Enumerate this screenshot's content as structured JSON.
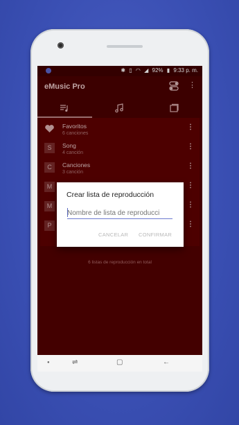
{
  "status_bar": {
    "icons": [
      "bluetooth-icon",
      "vibrate-icon",
      "wifi-icon",
      "signal-icon"
    ],
    "battery": "92%",
    "time": "9:33 p. m."
  },
  "app_bar": {
    "title": "eMusic Pro",
    "more": "⋮"
  },
  "tabs": [
    {
      "icon": "playlist-icon",
      "active": true
    },
    {
      "icon": "music-note-icon",
      "active": false
    },
    {
      "icon": "folder-icon",
      "active": false
    }
  ],
  "playlists": [
    {
      "name": "Favoritos",
      "sub": "6 canciones",
      "icon": "♥"
    },
    {
      "name": "Song",
      "sub": "4 canción",
      "icon": "S"
    },
    {
      "name": "Canciones",
      "sub": "3 canción",
      "icon": "C"
    },
    {
      "name": "",
      "sub": "",
      "icon": "M"
    },
    {
      "name": "",
      "sub": "",
      "icon": "M"
    },
    {
      "name": "",
      "sub": "",
      "icon": "P"
    }
  ],
  "row_menu": "⋮",
  "footer": "6 listas de reproducción en total",
  "dialog": {
    "title": "Crear lista de reproducción",
    "placeholder": "Nombre de lista de reproducci",
    "cancel": "CANCELAR",
    "confirm": "CONFIRMAR"
  },
  "colors": {
    "background": "#3a4fb3",
    "app_background": "#520000",
    "accent": "#5c6bc0"
  }
}
